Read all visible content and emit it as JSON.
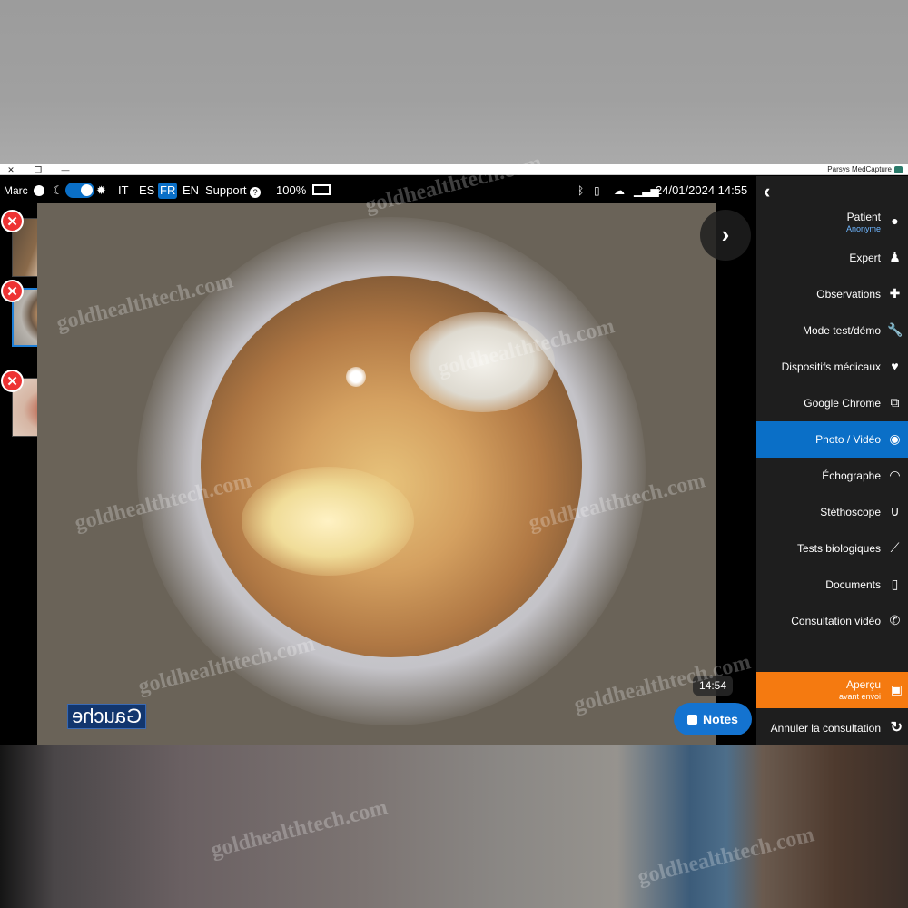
{
  "window": {
    "title": "Parsys MedCapture",
    "controls": {
      "close": "✕",
      "restore": "❐",
      "minimize": "—"
    }
  },
  "statusbar": {
    "user": "Marc",
    "languages": [
      "IT",
      "ES",
      "FR",
      "EN"
    ],
    "active_language": "FR",
    "support": "Support",
    "battery": "100%",
    "datetime": "24/01/2024 14:55"
  },
  "thumbnails": [
    {
      "name": "hand",
      "selected": false
    },
    {
      "name": "ear-canal",
      "selected": true
    },
    {
      "name": "lesion",
      "selected": false
    }
  ],
  "video": {
    "side_label": "Gauche",
    "timecode": "14:54",
    "notes_label": "Notes"
  },
  "menu": {
    "items": [
      {
        "label": "Patient",
        "sub": "Anonyme",
        "icon": "person-icon"
      },
      {
        "label": "Expert",
        "icon": "doctor-icon"
      },
      {
        "label": "Observations",
        "icon": "ambulance-icon"
      },
      {
        "label": "Mode test/démo",
        "icon": "wrench-icon"
      },
      {
        "label": "Dispositifs médicaux",
        "icon": "heart-pulse-icon"
      },
      {
        "label": "Google Chrome",
        "icon": "external-link-icon"
      },
      {
        "label": "Photo / Vidéo",
        "icon": "camera-icon",
        "active": true
      },
      {
        "label": "Échographe",
        "icon": "wifi-icon"
      },
      {
        "label": "Stéthoscope",
        "icon": "stethoscope-icon"
      },
      {
        "label": "Tests biologiques",
        "icon": "pipette-icon"
      },
      {
        "label": "Documents",
        "icon": "document-icon"
      },
      {
        "label": "Consultation vidéo",
        "icon": "phone-icon"
      }
    ],
    "apercu": {
      "label": "Aperçu",
      "sub": "avant envoi"
    },
    "annuler": "Annuler la consultation"
  },
  "watermark": "goldhealthtech.com",
  "colors": {
    "accent": "#0a6fc7",
    "apercu": "#f57a10",
    "delete": "#e33333",
    "menu_bg": "#1e1e1e"
  }
}
